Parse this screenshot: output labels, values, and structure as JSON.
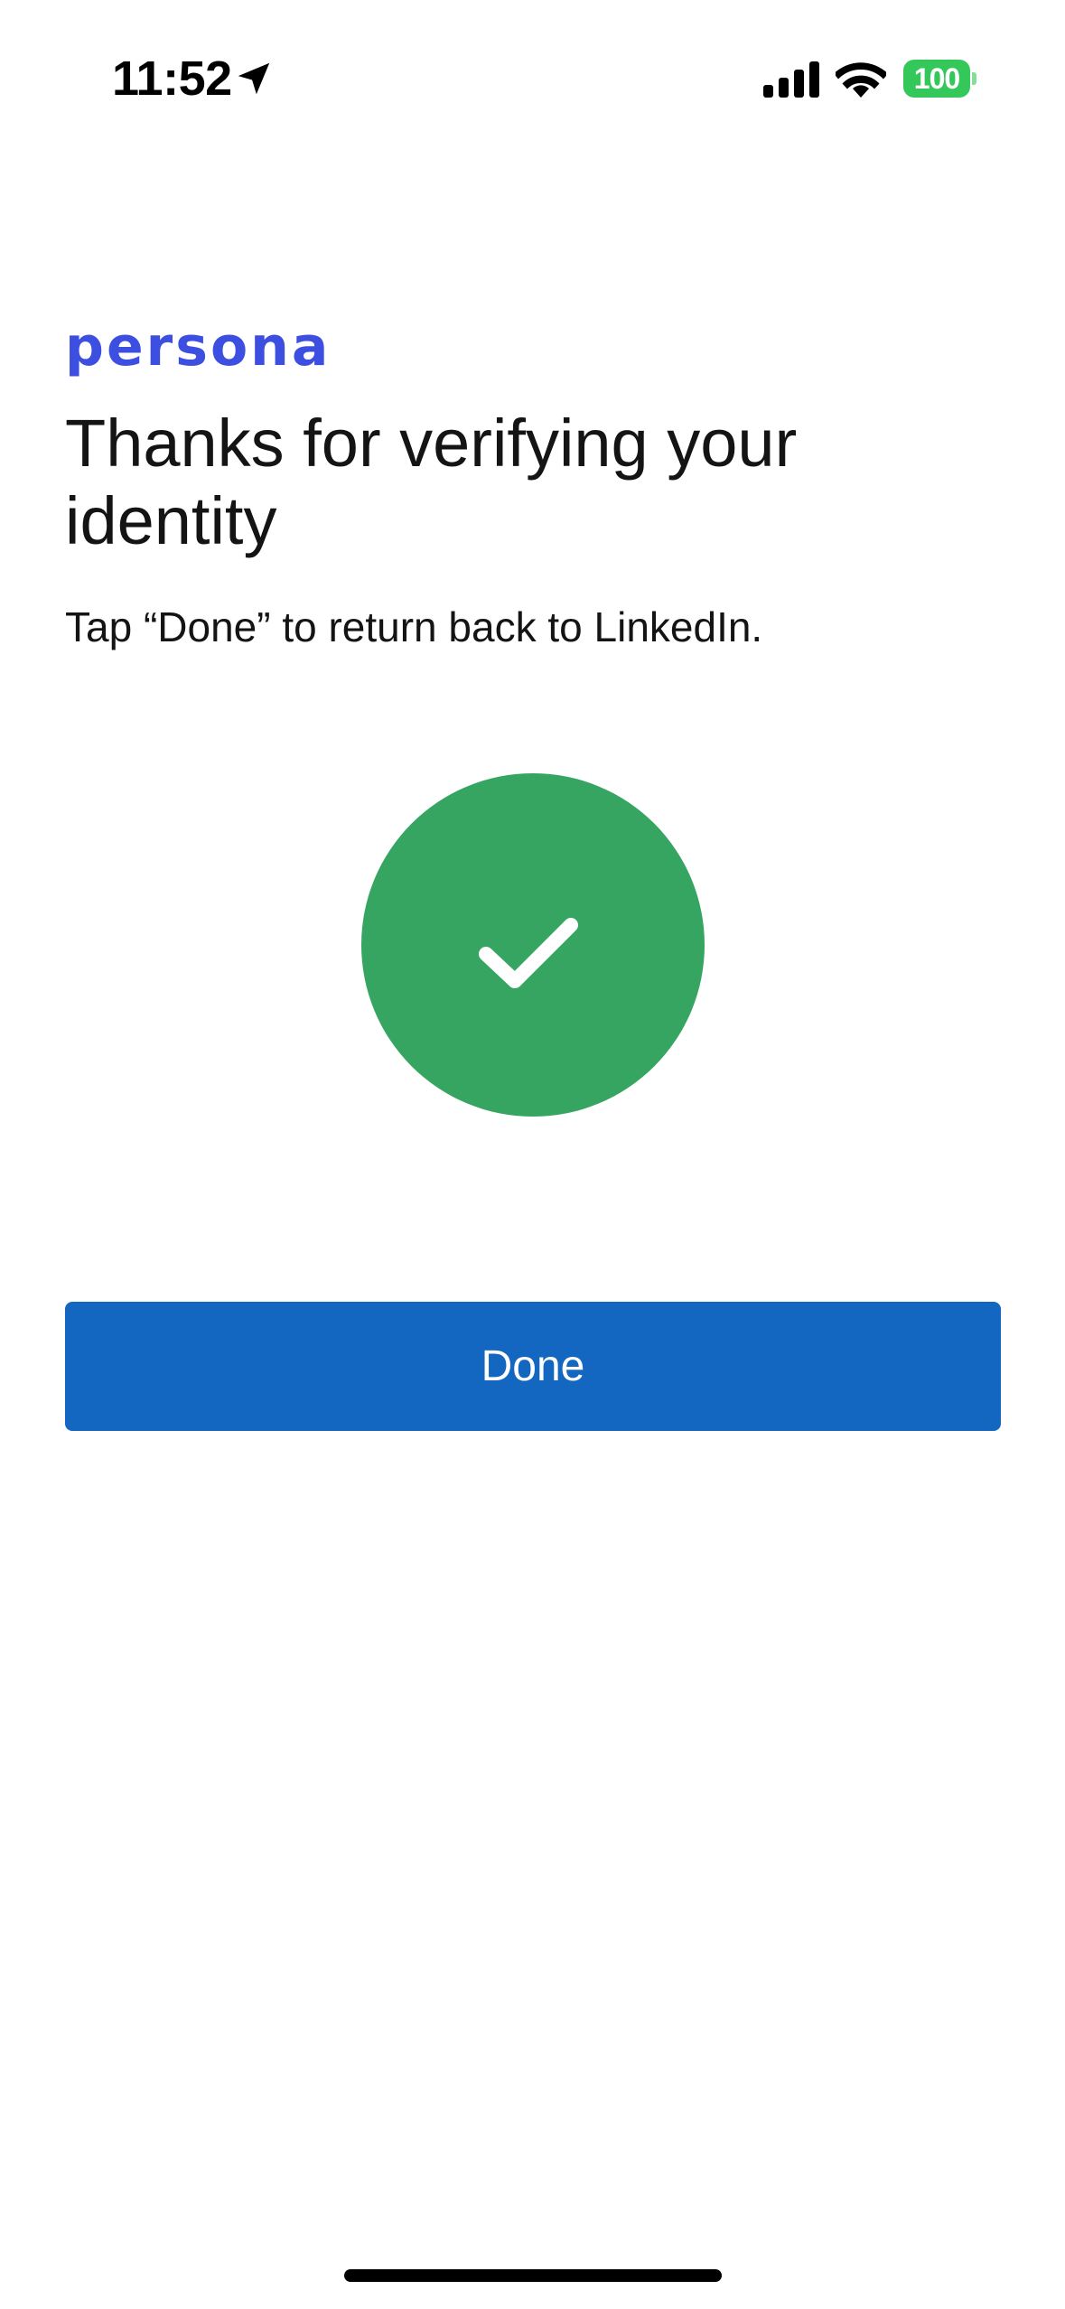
{
  "status_bar": {
    "time": "11:52",
    "battery_level": "100",
    "battery_color": "#34c759",
    "icons": [
      "location-arrow-icon",
      "cellular-signal-icon",
      "wifi-icon",
      "battery-icon"
    ]
  },
  "brand": {
    "logo_text": "persona",
    "color": "#3d4fe0"
  },
  "main": {
    "title": "Thanks for verifying your identity",
    "subtitle": "Tap “Done” to return back to LinkedIn.",
    "success_icon": "checkmark-icon",
    "success_color": "#37a562"
  },
  "actions": {
    "done_label": "Done",
    "button_color": "#1467c1"
  }
}
